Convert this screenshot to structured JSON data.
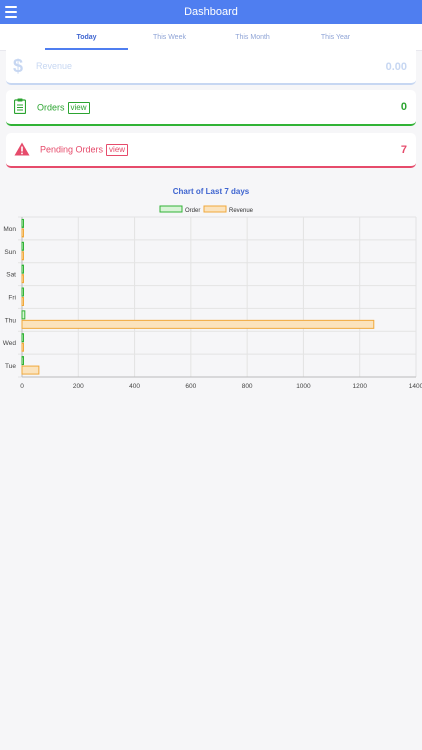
{
  "header": {
    "title": "Dashboard"
  },
  "tabs": [
    {
      "label": "Today"
    },
    {
      "label": "This Week"
    },
    {
      "label": "This Month"
    },
    {
      "label": "This Year"
    }
  ],
  "cards": {
    "revenue": {
      "label": "Revenue",
      "value": "0.00"
    },
    "orders": {
      "label": "Orders",
      "view": "view",
      "value": "0"
    },
    "pending": {
      "label": "Pending Orders",
      "view": "view",
      "value": "7"
    }
  },
  "colors": {
    "primary": "#4f7ef0",
    "order": "#31b336",
    "pending": "#e64b6b",
    "revenue_bar_fill": "#fbe3bd",
    "revenue_bar_stroke": "#f0a83c"
  },
  "chart_data": {
    "type": "bar",
    "orientation": "horizontal",
    "title": "Chart of Last 7 days",
    "categories": [
      "Mon",
      "Sun",
      "Sat",
      "Fri",
      "Thu",
      "Wed",
      "Tue"
    ],
    "series": [
      {
        "name": "Order",
        "values": [
          2,
          2,
          2,
          2,
          10,
          2,
          5
        ]
      },
      {
        "name": "Revenue",
        "values": [
          0,
          0,
          0,
          0,
          1250,
          0,
          60
        ]
      }
    ],
    "xlim": [
      0,
      1400
    ],
    "xticks": [
      0,
      200,
      400,
      600,
      800,
      1000,
      1200,
      1400
    ],
    "grid": true,
    "legend": "top"
  }
}
